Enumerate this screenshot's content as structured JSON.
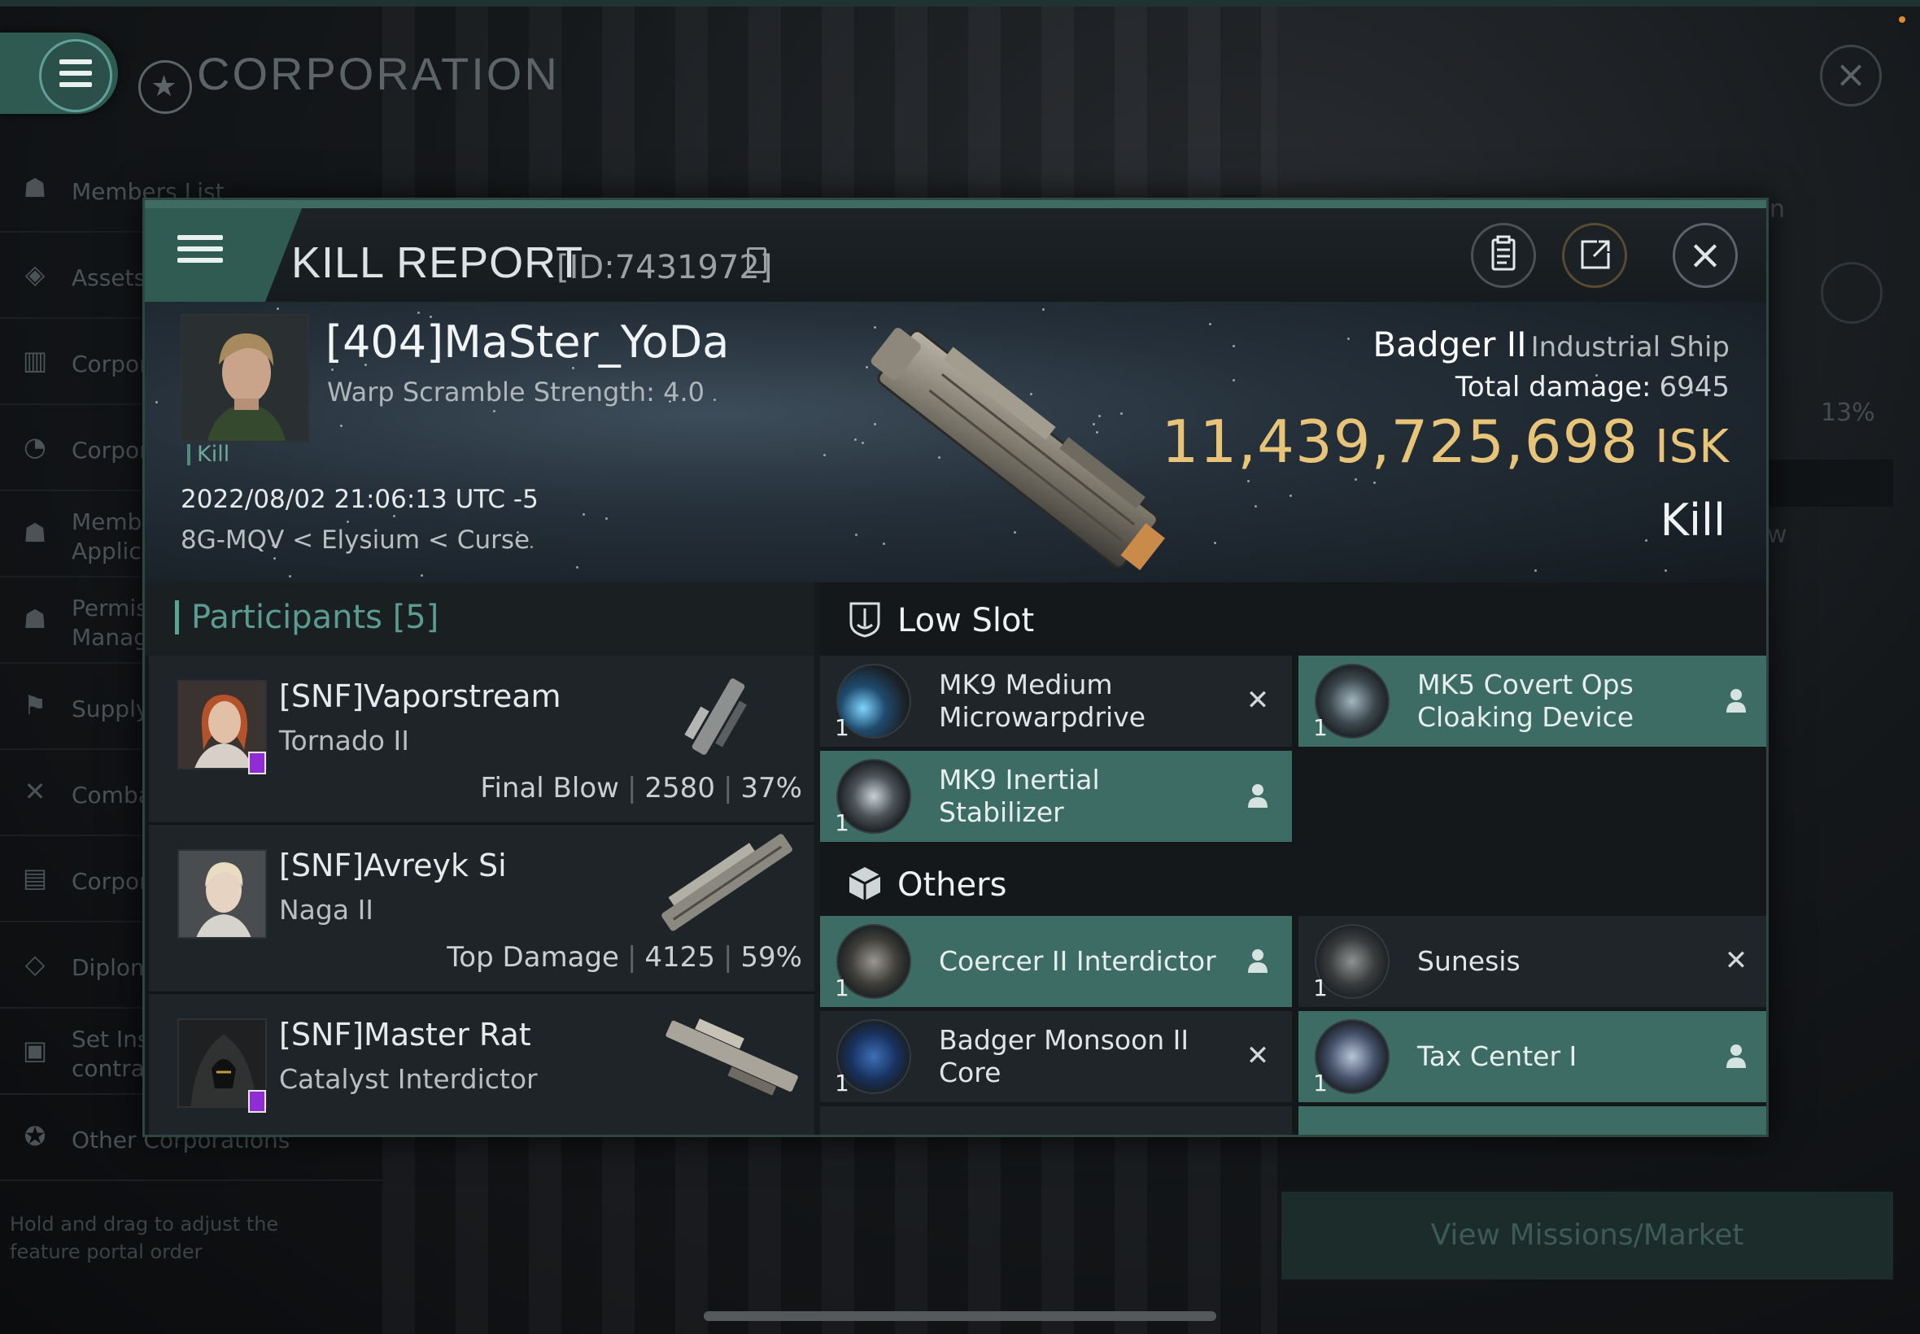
{
  "background": {
    "title": "CORPORATION",
    "sidebar": [
      {
        "label": "Members List",
        "icon": "members-icon"
      },
      {
        "label": "Assets",
        "icon": "assets-icon"
      },
      {
        "label": "Corpor",
        "icon": "corp-stats-icon"
      },
      {
        "label": "Corpor",
        "icon": "corp-pie-icon"
      },
      {
        "label": "Memb\nApplic",
        "icon": "applications-icon"
      },
      {
        "label": "Permis\nManag",
        "icon": "permissions-icon"
      },
      {
        "label": "Supply",
        "icon": "supply-icon"
      },
      {
        "label": "Comba",
        "icon": "combat-icon"
      },
      {
        "label": "Corpor",
        "icon": "corp-doc-icon"
      },
      {
        "label": "Diplom",
        "icon": "diplomacy-icon"
      },
      {
        "label": "Set Ins\ncontra",
        "icon": "insurance-icon"
      },
      {
        "label": "Other Corporations",
        "icon": "star-icon"
      }
    ],
    "sidebar_hint": "Hold and drag to adjust the feature portal order",
    "right_fragments": {
      "a": "n",
      "b": "13%",
      "c": "w"
    },
    "mission_button": "View Missions/Market"
  },
  "modal": {
    "title": "KILL REPORT",
    "id_text": "[ID:7431972]",
    "victim": {
      "name": "[404]MaSter_YoDa",
      "warp_scramble": "Warp Scramble Strength: 4.0",
      "tag": "Kill",
      "datetime": "2022/08/02 21:06:13 UTC -5",
      "location": "8G-MQV < Elysium < Curse",
      "ship": "Badger II",
      "ship_class": "Industrial Ship",
      "damage_label": "Total damage:",
      "damage_value": "6945",
      "isk_value": "11,439,725,698",
      "isk_unit": "ISK",
      "result": "Kill"
    },
    "participants": {
      "label": "Participants",
      "count": "[5]",
      "rows": [
        {
          "name": "[SNF]Vaporstream",
          "ship": "Tornado II",
          "role": "Final Blow",
          "damage": "2580",
          "percent": "37%"
        },
        {
          "name": "[SNF]Avreyk Si",
          "ship": "Naga II",
          "role": "Top Damage",
          "damage": "4125",
          "percent": "59%"
        },
        {
          "name": "[SNF]Master Rat",
          "ship": "Catalyst Interdictor",
          "role": "",
          "damage": "",
          "percent": ""
        }
      ]
    },
    "low_slot": {
      "label": "Low Slot",
      "items": [
        {
          "qty": "1",
          "name": "MK9 Medium Microwarpdrive",
          "status": "destroyed"
        },
        {
          "qty": "1",
          "name": "MK5 Covert Ops Cloaking Device",
          "status": "dropped"
        },
        {
          "qty": "1",
          "name": "MK9 Inertial Stabilizer",
          "status": "dropped"
        }
      ]
    },
    "others": {
      "label": "Others",
      "items": [
        {
          "qty": "1",
          "name": "Coercer II Interdictor",
          "status": "dropped"
        },
        {
          "qty": "1",
          "name": "Sunesis",
          "status": "destroyed"
        },
        {
          "qty": "1",
          "name": "Badger Monsoon II Core",
          "status": "destroyed"
        },
        {
          "qty": "1",
          "name": "Tax Center I",
          "status": "dropped"
        }
      ]
    }
  }
}
